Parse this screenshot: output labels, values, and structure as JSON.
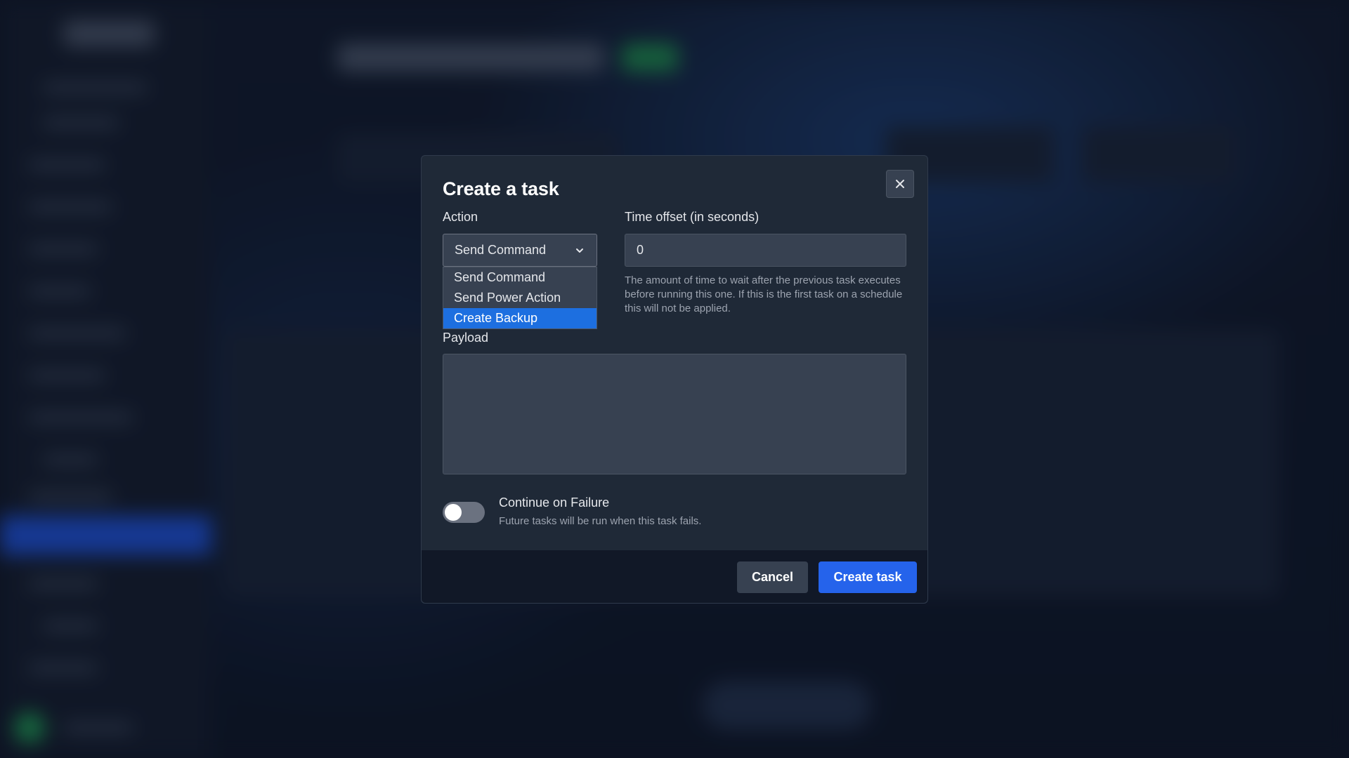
{
  "modal": {
    "title": "Create a task",
    "close_icon": "close-icon",
    "action": {
      "label": "Action",
      "selected": "Send Command",
      "options": [
        "Send Command",
        "Send Power Action",
        "Create Backup"
      ],
      "highlighted": "Create Backup"
    },
    "time_offset": {
      "label": "Time offset (in seconds)",
      "value": "0",
      "help": "The amount of time to wait after the previous task executes before running this one. If this is the first task on a schedule this will not be applied."
    },
    "payload": {
      "label": "Payload",
      "value": ""
    },
    "continue_on_failure": {
      "label": "Continue on Failure",
      "description": "Future tasks will be run when this task fails.",
      "enabled": false
    },
    "buttons": {
      "cancel": "Cancel",
      "create": "Create task"
    }
  },
  "colors": {
    "primary": "#2563eb",
    "highlight": "#1d6fe0",
    "modal_bg": "#1f2937",
    "footer_bg": "#111827"
  }
}
